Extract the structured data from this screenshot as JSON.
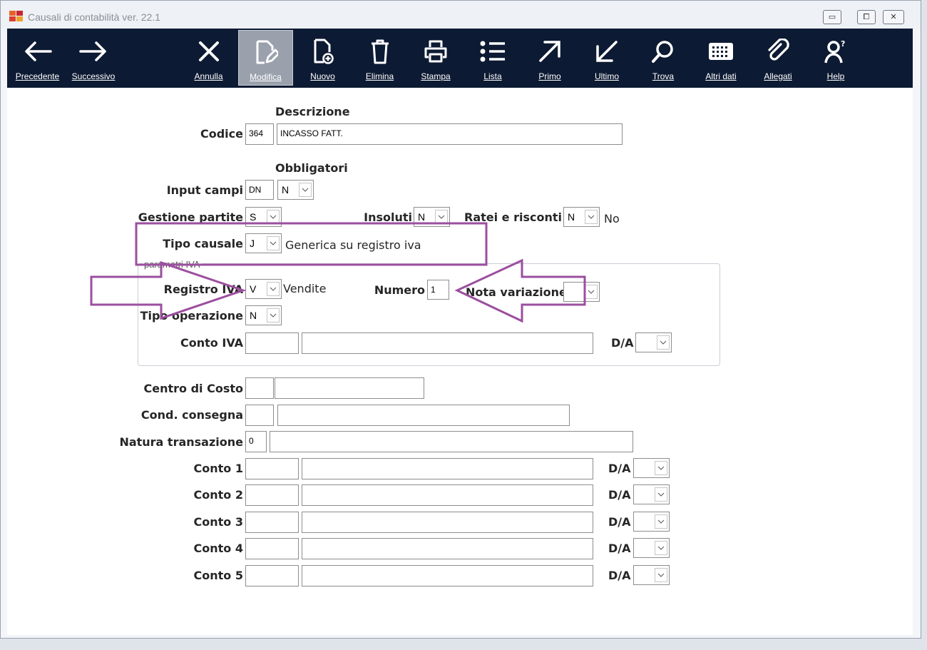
{
  "window": {
    "title": "Causali di contabilità ver. 22.1",
    "controls": {
      "minimize": "▭",
      "maximize": "⧠",
      "close": "✕"
    }
  },
  "toolbar": {
    "items": [
      {
        "id": "precedente",
        "label": "Precedente",
        "icon": "arrow-left-icon",
        "active": false
      },
      {
        "id": "successivo",
        "label": "Successivo",
        "icon": "arrow-right-icon",
        "active": false
      },
      {
        "id": "annulla",
        "label": "Annulla",
        "icon": "close-icon",
        "active": false
      },
      {
        "id": "modifica",
        "label": "Modifica",
        "icon": "edit-document-icon",
        "active": true
      },
      {
        "id": "nuovo",
        "label": "Nuovo",
        "icon": "new-document-icon",
        "active": false
      },
      {
        "id": "elimina",
        "label": "Elimina",
        "icon": "trash-icon",
        "active": false
      },
      {
        "id": "stampa",
        "label": "Stampa",
        "icon": "print-icon",
        "active": false
      },
      {
        "id": "lista",
        "label": "Lista",
        "icon": "list-icon",
        "active": false
      },
      {
        "id": "primo",
        "label": "Primo",
        "icon": "arrow-up-right-icon",
        "active": false
      },
      {
        "id": "ultimo",
        "label": "Ultimo",
        "icon": "arrow-down-left-icon",
        "active": false
      },
      {
        "id": "trova",
        "label": "Trova",
        "icon": "search-icon",
        "active": false
      },
      {
        "id": "altri_dati",
        "label": "Altri dati",
        "icon": "keyboard-icon",
        "active": false
      },
      {
        "id": "allegati",
        "label": "Allegati",
        "icon": "paperclip-icon",
        "active": false
      },
      {
        "id": "help",
        "label": "Help",
        "icon": "help-person-icon",
        "active": false
      }
    ]
  },
  "form": {
    "descrizione_header": "Descrizione",
    "codice": {
      "label": "Codice",
      "value": "364",
      "descrizione": "INCASSO FATT."
    },
    "obbligatori_header": "Obbligatori",
    "input_campi": {
      "label": "Input campi",
      "value": "DN",
      "select": "N"
    },
    "gestione_partite": {
      "label": "Gestione partite",
      "value": "S"
    },
    "insoluti": {
      "label": "Insoluti",
      "value": "N"
    },
    "ratei_risconti": {
      "label": "Ratei e risconti",
      "value": "N",
      "desc": "No"
    },
    "tipo_causale": {
      "label": "Tipo causale",
      "value": "J",
      "desc": "Generica su registro iva"
    },
    "parametri_iva": {
      "group_label": "parametri IVA",
      "registro_iva": {
        "label": "Registro IVA",
        "value": "V",
        "desc": "Vendite"
      },
      "numero": {
        "label": "Numero",
        "value": "1"
      },
      "nota_variazione": {
        "label": "Nota variazione",
        "value": ""
      },
      "tipo_operazione": {
        "label": "Tipo operazione",
        "value": "N"
      },
      "conto_iva": {
        "label": "Conto IVA",
        "code": "",
        "desc": "",
        "da_label": "D/A",
        "da_value": ""
      }
    },
    "centro_costo": {
      "label": "Centro di Costo",
      "code": "",
      "desc": ""
    },
    "cond_consegna": {
      "label": "Cond. consegna",
      "code": "",
      "desc": ""
    },
    "natura_transazione": {
      "label": "Natura transazione",
      "value": "0",
      "desc": ""
    },
    "conti": [
      {
        "label": "Conto 1",
        "code": "",
        "desc": "",
        "da_label": "D/A",
        "da_value": ""
      },
      {
        "label": "Conto 2",
        "code": "",
        "desc": "",
        "da_label": "D/A",
        "da_value": ""
      },
      {
        "label": "Conto 3",
        "code": "",
        "desc": "",
        "da_label": "D/A",
        "da_value": ""
      },
      {
        "label": "Conto 4",
        "code": "",
        "desc": "",
        "da_label": "D/A",
        "da_value": ""
      },
      {
        "label": "Conto 5",
        "code": "",
        "desc": "",
        "da_label": "D/A",
        "da_value": ""
      }
    ]
  },
  "colors": {
    "toolbar_bg": "#0d1a33",
    "annotation": "#9b4f9f",
    "app_icon": [
      "#e8622c",
      "#c6262e",
      "#f0a02c",
      "#d9412c"
    ]
  }
}
